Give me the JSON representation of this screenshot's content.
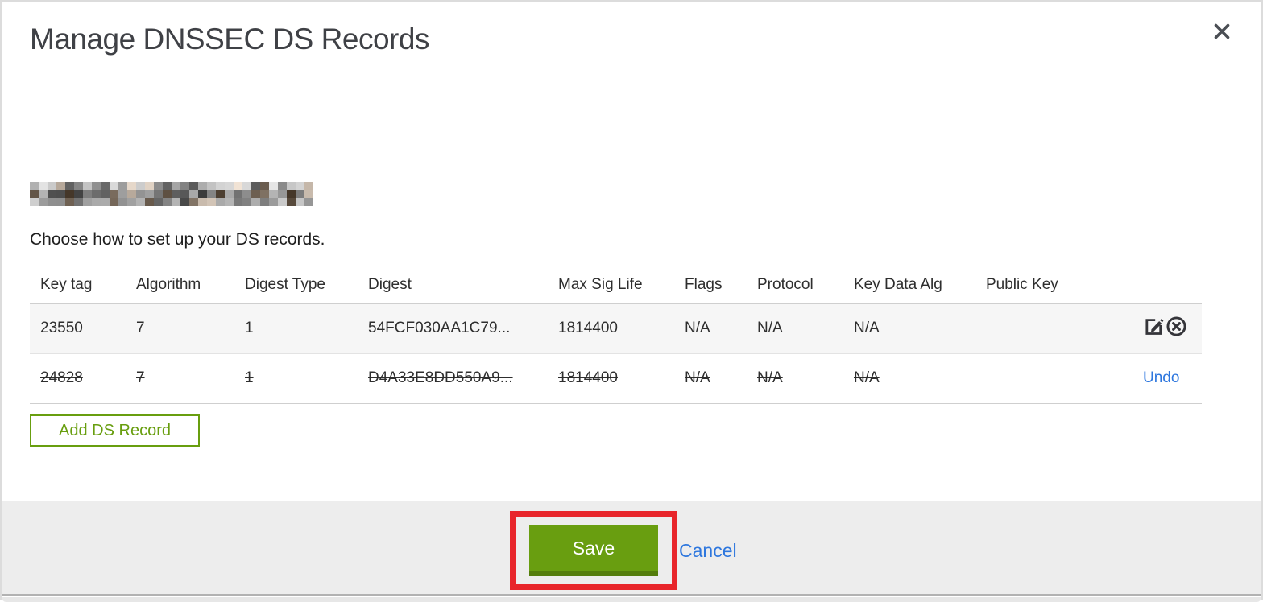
{
  "dialog": {
    "title": "Manage DNSSEC DS Records",
    "subtitle": "Choose how to set up your DS records.",
    "domain_redacted": true
  },
  "icons": {
    "close": "close-icon",
    "edit": "edit-icon",
    "delete": "delete-circle-icon"
  },
  "table": {
    "columns": [
      "Key tag",
      "Algorithm",
      "Digest Type",
      "Digest",
      "Max Sig Life",
      "Flags",
      "Protocol",
      "Key Data Alg",
      "Public Key"
    ],
    "rows": [
      {
        "key_tag": "23550",
        "algorithm": "7",
        "digest_type": "1",
        "digest": "54FCF030AA1C79...",
        "max_sig_life": "1814400",
        "flags": "N/A",
        "protocol": "N/A",
        "key_data_alg": "N/A",
        "public_key": "",
        "state": "normal"
      },
      {
        "key_tag": "24828",
        "algorithm": "7",
        "digest_type": "1",
        "digest": "D4A33E8DD550A9...",
        "max_sig_life": "1814400",
        "flags": "N/A",
        "protocol": "N/A",
        "key_data_alg": "N/A",
        "public_key": "",
        "state": "deleted",
        "undo_label": "Undo"
      }
    ],
    "add_button_label": "Add DS Record"
  },
  "footer": {
    "save_label": "Save",
    "cancel_label": "Cancel"
  },
  "colors": {
    "green": "#699e10",
    "green_dark": "#547d0c",
    "blue_link": "#2e77de",
    "red_annotation": "#e8252b",
    "row_alt_bg": "#f6f6f6",
    "footer_bg": "#ededed"
  }
}
